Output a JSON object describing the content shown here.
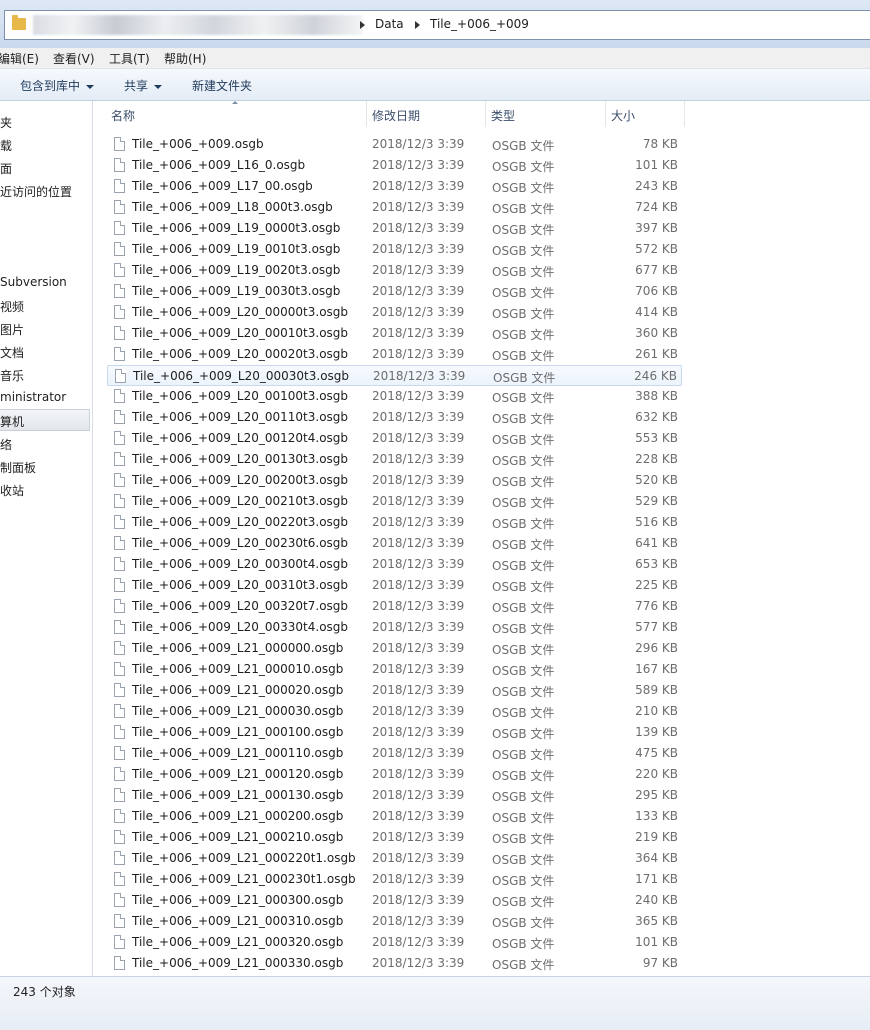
{
  "address": {
    "crumbs": [
      "Data",
      "Tile_+006_+009"
    ]
  },
  "menu": [
    "编辑(E)",
    "查看(V)",
    "工具(T)",
    "帮助(H)"
  ],
  "toolbar": {
    "include_library": "包含到库中",
    "share": "共享",
    "new_folder": "新建文件夹"
  },
  "nav": [
    "夹",
    "载",
    "面",
    "近访问的位置",
    "Subversion",
    "视频",
    "图片",
    "文档",
    "音乐",
    "ministrator",
    "算机",
    "络",
    "制面板",
    "收站"
  ],
  "columns": {
    "name": "名称",
    "date": "修改日期",
    "type": "类型",
    "size": "大小"
  },
  "files": [
    {
      "name": "Tile_+006_+009.osgb",
      "date": "2018/12/3 3:39",
      "type": "OSGB 文件",
      "size": "78 KB"
    },
    {
      "name": "Tile_+006_+009_L16_0.osgb",
      "date": "2018/12/3 3:39",
      "type": "OSGB 文件",
      "size": "101 KB"
    },
    {
      "name": "Tile_+006_+009_L17_00.osgb",
      "date": "2018/12/3 3:39",
      "type": "OSGB 文件",
      "size": "243 KB"
    },
    {
      "name": "Tile_+006_+009_L18_000t3.osgb",
      "date": "2018/12/3 3:39",
      "type": "OSGB 文件",
      "size": "724 KB"
    },
    {
      "name": "Tile_+006_+009_L19_0000t3.osgb",
      "date": "2018/12/3 3:39",
      "type": "OSGB 文件",
      "size": "397 KB"
    },
    {
      "name": "Tile_+006_+009_L19_0010t3.osgb",
      "date": "2018/12/3 3:39",
      "type": "OSGB 文件",
      "size": "572 KB"
    },
    {
      "name": "Tile_+006_+009_L19_0020t3.osgb",
      "date": "2018/12/3 3:39",
      "type": "OSGB 文件",
      "size": "677 KB"
    },
    {
      "name": "Tile_+006_+009_L19_0030t3.osgb",
      "date": "2018/12/3 3:39",
      "type": "OSGB 文件",
      "size": "706 KB"
    },
    {
      "name": "Tile_+006_+009_L20_00000t3.osgb",
      "date": "2018/12/3 3:39",
      "type": "OSGB 文件",
      "size": "414 KB"
    },
    {
      "name": "Tile_+006_+009_L20_00010t3.osgb",
      "date": "2018/12/3 3:39",
      "type": "OSGB 文件",
      "size": "360 KB"
    },
    {
      "name": "Tile_+006_+009_L20_00020t3.osgb",
      "date": "2018/12/3 3:39",
      "type": "OSGB 文件",
      "size": "261 KB"
    },
    {
      "name": "Tile_+006_+009_L20_00030t3.osgb",
      "date": "2018/12/3 3:39",
      "type": "OSGB 文件",
      "size": "246 KB"
    },
    {
      "name": "Tile_+006_+009_L20_00100t3.osgb",
      "date": "2018/12/3 3:39",
      "type": "OSGB 文件",
      "size": "388 KB"
    },
    {
      "name": "Tile_+006_+009_L20_00110t3.osgb",
      "date": "2018/12/3 3:39",
      "type": "OSGB 文件",
      "size": "632 KB"
    },
    {
      "name": "Tile_+006_+009_L20_00120t4.osgb",
      "date": "2018/12/3 3:39",
      "type": "OSGB 文件",
      "size": "553 KB"
    },
    {
      "name": "Tile_+006_+009_L20_00130t3.osgb",
      "date": "2018/12/3 3:39",
      "type": "OSGB 文件",
      "size": "228 KB"
    },
    {
      "name": "Tile_+006_+009_L20_00200t3.osgb",
      "date": "2018/12/3 3:39",
      "type": "OSGB 文件",
      "size": "520 KB"
    },
    {
      "name": "Tile_+006_+009_L20_00210t3.osgb",
      "date": "2018/12/3 3:39",
      "type": "OSGB 文件",
      "size": "529 KB"
    },
    {
      "name": "Tile_+006_+009_L20_00220t3.osgb",
      "date": "2018/12/3 3:39",
      "type": "OSGB 文件",
      "size": "516 KB"
    },
    {
      "name": "Tile_+006_+009_L20_00230t6.osgb",
      "date": "2018/12/3 3:39",
      "type": "OSGB 文件",
      "size": "641 KB"
    },
    {
      "name": "Tile_+006_+009_L20_00300t4.osgb",
      "date": "2018/12/3 3:39",
      "type": "OSGB 文件",
      "size": "653 KB"
    },
    {
      "name": "Tile_+006_+009_L20_00310t3.osgb",
      "date": "2018/12/3 3:39",
      "type": "OSGB 文件",
      "size": "225 KB"
    },
    {
      "name": "Tile_+006_+009_L20_00320t7.osgb",
      "date": "2018/12/3 3:39",
      "type": "OSGB 文件",
      "size": "776 KB"
    },
    {
      "name": "Tile_+006_+009_L20_00330t4.osgb",
      "date": "2018/12/3 3:39",
      "type": "OSGB 文件",
      "size": "577 KB"
    },
    {
      "name": "Tile_+006_+009_L21_000000.osgb",
      "date": "2018/12/3 3:39",
      "type": "OSGB 文件",
      "size": "296 KB"
    },
    {
      "name": "Tile_+006_+009_L21_000010.osgb",
      "date": "2018/12/3 3:39",
      "type": "OSGB 文件",
      "size": "167 KB"
    },
    {
      "name": "Tile_+006_+009_L21_000020.osgb",
      "date": "2018/12/3 3:39",
      "type": "OSGB 文件",
      "size": "589 KB"
    },
    {
      "name": "Tile_+006_+009_L21_000030.osgb",
      "date": "2018/12/3 3:39",
      "type": "OSGB 文件",
      "size": "210 KB"
    },
    {
      "name": "Tile_+006_+009_L21_000100.osgb",
      "date": "2018/12/3 3:39",
      "type": "OSGB 文件",
      "size": "139 KB"
    },
    {
      "name": "Tile_+006_+009_L21_000110.osgb",
      "date": "2018/12/3 3:39",
      "type": "OSGB 文件",
      "size": "475 KB"
    },
    {
      "name": "Tile_+006_+009_L21_000120.osgb",
      "date": "2018/12/3 3:39",
      "type": "OSGB 文件",
      "size": "220 KB"
    },
    {
      "name": "Tile_+006_+009_L21_000130.osgb",
      "date": "2018/12/3 3:39",
      "type": "OSGB 文件",
      "size": "295 KB"
    },
    {
      "name": "Tile_+006_+009_L21_000200.osgb",
      "date": "2018/12/3 3:39",
      "type": "OSGB 文件",
      "size": "133 KB"
    },
    {
      "name": "Tile_+006_+009_L21_000210.osgb",
      "date": "2018/12/3 3:39",
      "type": "OSGB 文件",
      "size": "219 KB"
    },
    {
      "name": "Tile_+006_+009_L21_000220t1.osgb",
      "date": "2018/12/3 3:39",
      "type": "OSGB 文件",
      "size": "364 KB"
    },
    {
      "name": "Tile_+006_+009_L21_000230t1.osgb",
      "date": "2018/12/3 3:39",
      "type": "OSGB 文件",
      "size": "171 KB"
    },
    {
      "name": "Tile_+006_+009_L21_000300.osgb",
      "date": "2018/12/3 3:39",
      "type": "OSGB 文件",
      "size": "240 KB"
    },
    {
      "name": "Tile_+006_+009_L21_000310.osgb",
      "date": "2018/12/3 3:39",
      "type": "OSGB 文件",
      "size": "365 KB"
    },
    {
      "name": "Tile_+006_+009_L21_000320.osgb",
      "date": "2018/12/3 3:39",
      "type": "OSGB 文件",
      "size": "101 KB"
    },
    {
      "name": "Tile_+006_+009_L21_000330.osgb",
      "date": "2018/12/3 3:39",
      "type": "OSGB 文件",
      "size": "97 KB"
    }
  ],
  "status": {
    "count_text": "243 个对象"
  }
}
